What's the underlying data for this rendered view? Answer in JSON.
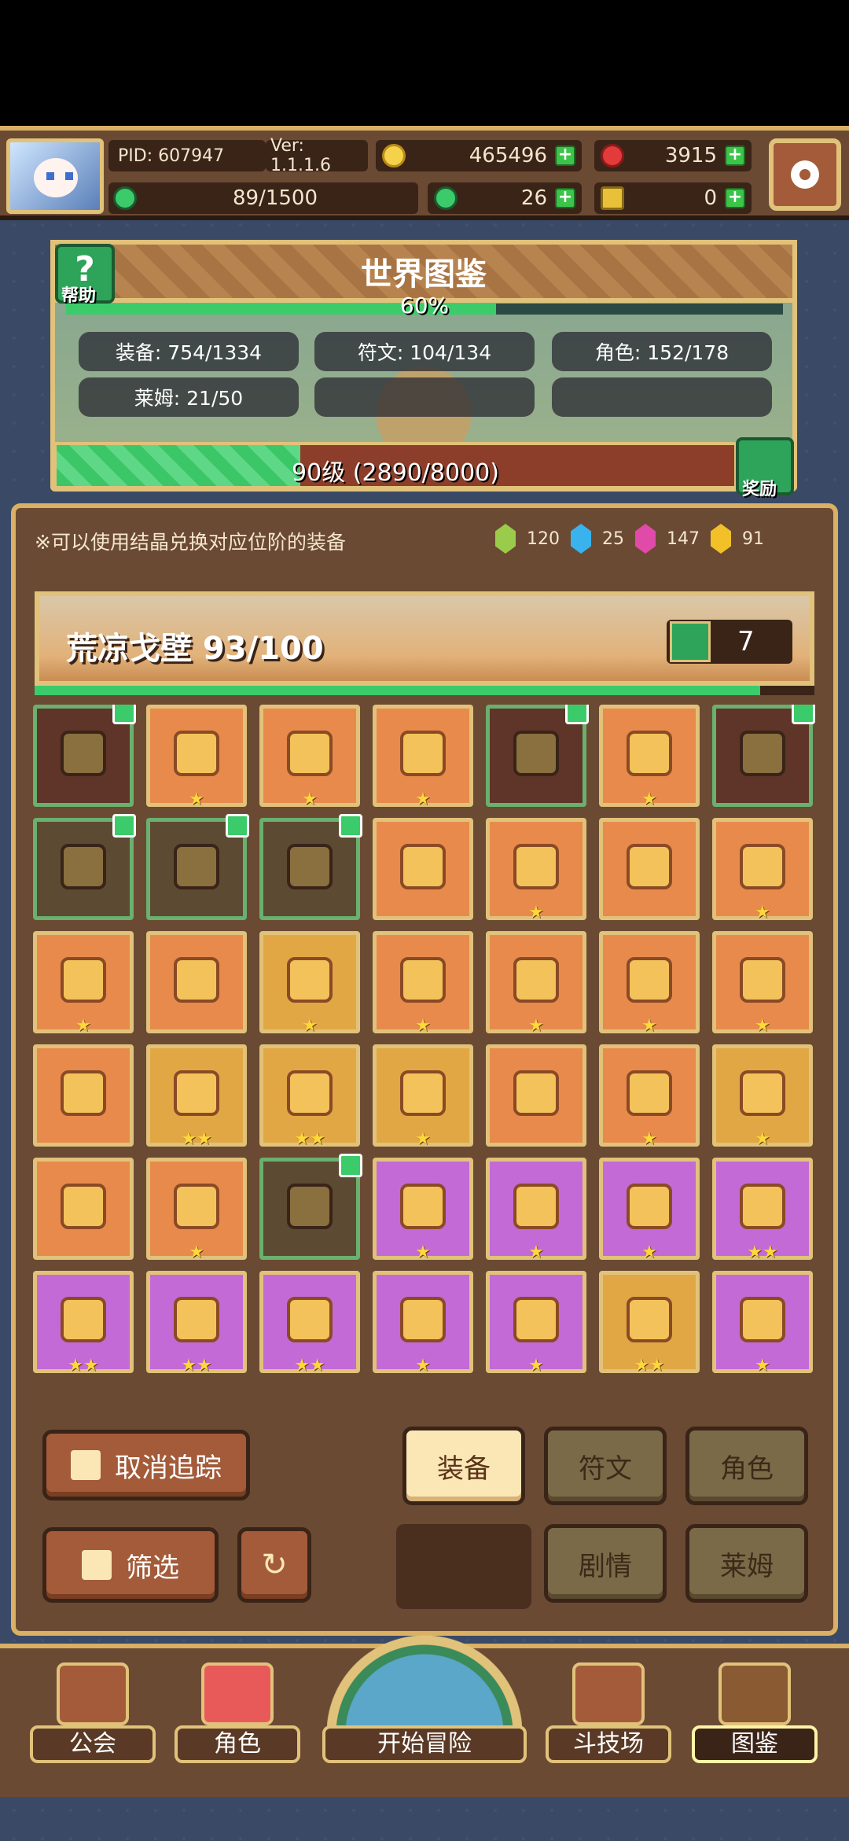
{
  "header": {
    "pid": "PID: 607947",
    "version": "Ver: 1.1.1.6",
    "gold": "465496",
    "gems": "3915",
    "stamina": "89/1500",
    "clover": "26",
    "keys": "0"
  },
  "world": {
    "title": "世界图鉴",
    "help_label": "帮助",
    "percent": "60%",
    "stats": {
      "equip": "装备: 754/1334",
      "rune": "符文: 104/134",
      "role": "角色: 152/178",
      "slime": "莱姆: 21/50"
    },
    "level": "90级  (2890/8000)",
    "level_progress": 0.36,
    "reward_label": "奖励"
  },
  "notice": "※可以使用结晶兑换对应位阶的装备",
  "crystals": [
    {
      "color": "#9acb4a",
      "count": "120"
    },
    {
      "color": "#3ab2ee",
      "count": "25"
    },
    {
      "color": "#e04aa8",
      "count": "147"
    },
    {
      "color": "#f2c12a",
      "count": "91"
    }
  ],
  "region": {
    "name": "荒凉戈壁  93/100",
    "likes": "7"
  },
  "items": [
    {
      "icon": "heart-amulet-icon",
      "bg": "dark",
      "stars": "",
      "tracked": true
    },
    {
      "icon": "gauntlet-icon",
      "bg": "orange",
      "stars": "★",
      "tracked": false
    },
    {
      "icon": "ring-icon",
      "bg": "orange",
      "stars": "★",
      "tracked": false
    },
    {
      "icon": "gold-necklace-icon",
      "bg": "orange",
      "stars": "★",
      "tracked": false
    },
    {
      "icon": "staff-icon",
      "bg": "dark",
      "stars": "",
      "tracked": true
    },
    {
      "icon": "ruby-amulet-icon",
      "bg": "orange",
      "stars": "★",
      "tracked": false
    },
    {
      "icon": "winged-armor-icon",
      "bg": "dark",
      "stars": "",
      "tracked": true
    },
    {
      "icon": "mace-icon",
      "bg": "darkg",
      "stars": "",
      "tracked": true
    },
    {
      "icon": "horned-helmet-icon",
      "bg": "darkg",
      "stars": "",
      "tracked": true
    },
    {
      "icon": "robe-icon",
      "bg": "darkg",
      "stars": "",
      "tracked": true
    },
    {
      "icon": "cross-emblem-icon",
      "bg": "orange",
      "stars": "",
      "tracked": false
    },
    {
      "icon": "sapphire-necklace-icon",
      "bg": "orange",
      "stars": "★",
      "tracked": false
    },
    {
      "icon": "crystal-ring-icon",
      "bg": "orange",
      "stars": "",
      "tracked": false
    },
    {
      "icon": "gold-shield-icon",
      "bg": "orange",
      "stars": "★",
      "tracked": false
    },
    {
      "icon": "feather-charm-icon",
      "bg": "orange",
      "stars": "★",
      "tracked": false
    },
    {
      "icon": "gold-shoulder-icon",
      "bg": "orange",
      "stars": "",
      "tracked": false
    },
    {
      "icon": "winged-pendant-icon",
      "bg": "gold",
      "stars": "★",
      "tracked": false
    },
    {
      "icon": "gear-ring-icon",
      "bg": "orange",
      "stars": "★",
      "tracked": false
    },
    {
      "icon": "red-ring-icon",
      "bg": "orange",
      "stars": "★",
      "tracked": false
    },
    {
      "icon": "sword-icon",
      "bg": "orange",
      "stars": "★",
      "tracked": false
    },
    {
      "icon": "hood-icon",
      "bg": "orange",
      "stars": "★",
      "tracked": false
    },
    {
      "icon": "leaf-blade-icon",
      "bg": "orange",
      "stars": "",
      "tracked": false
    },
    {
      "icon": "dagger-icon",
      "bg": "gold",
      "stars": "★★",
      "tracked": false
    },
    {
      "icon": "gem-ring-icon",
      "bg": "gold",
      "stars": "★★",
      "tracked": false
    },
    {
      "icon": "gem-flower-icon",
      "bg": "gold",
      "stars": "★",
      "tracked": false
    },
    {
      "icon": "arrow-icon",
      "bg": "orange",
      "stars": "",
      "tracked": false
    },
    {
      "icon": "diamond-charm-icon",
      "bg": "orange",
      "stars": "★",
      "tracked": false
    },
    {
      "icon": "ruby-ring-icon",
      "bg": "gold",
      "stars": "★",
      "tracked": false
    },
    {
      "icon": "bow-icon",
      "bg": "orange",
      "stars": "",
      "tracked": false
    },
    {
      "icon": "crystal-armor-icon",
      "bg": "orange",
      "stars": "★",
      "tracked": false
    },
    {
      "icon": "boots-icon",
      "bg": "darkg",
      "stars": "",
      "tracked": true
    },
    {
      "icon": "collar-icon",
      "bg": "purple",
      "stars": "★",
      "tracked": false
    },
    {
      "icon": "chest-armor-icon",
      "bg": "purple",
      "stars": "★",
      "tracked": false
    },
    {
      "icon": "red-boots-icon",
      "bg": "purple",
      "stars": "★",
      "tracked": false
    },
    {
      "icon": "pistol-icon",
      "bg": "purple",
      "stars": "★★",
      "tracked": false
    },
    {
      "icon": "red-gauntlet-icon",
      "bg": "purple",
      "stars": "★★",
      "tracked": false
    },
    {
      "icon": "chain-necklace-icon",
      "bg": "purple",
      "stars": "★★",
      "tracked": false
    },
    {
      "icon": "dark-helmet-icon",
      "bg": "purple",
      "stars": "★★",
      "tracked": false
    },
    {
      "icon": "gold-armor-icon",
      "bg": "purple",
      "stars": "★",
      "tracked": false
    },
    {
      "icon": "dark-gauntlet-icon",
      "bg": "purple",
      "stars": "★",
      "tracked": false
    },
    {
      "icon": "jewel-cross-icon",
      "bg": "gold",
      "stars": "★★",
      "tracked": false
    },
    {
      "icon": "ruby-choker-icon",
      "bg": "purple",
      "stars": "★",
      "tracked": false
    }
  ],
  "controls": {
    "untrack": "取消追踪",
    "filter": "筛选",
    "tab_equip": "装备",
    "tab_rune": "符文",
    "tab_role": "角色",
    "tab_story": "剧情",
    "tab_slime": "莱姆"
  },
  "nav": {
    "guild": "公会",
    "role": "角色",
    "adventure": "开始冒险",
    "arena": "斗技场",
    "codex": "图鉴"
  }
}
